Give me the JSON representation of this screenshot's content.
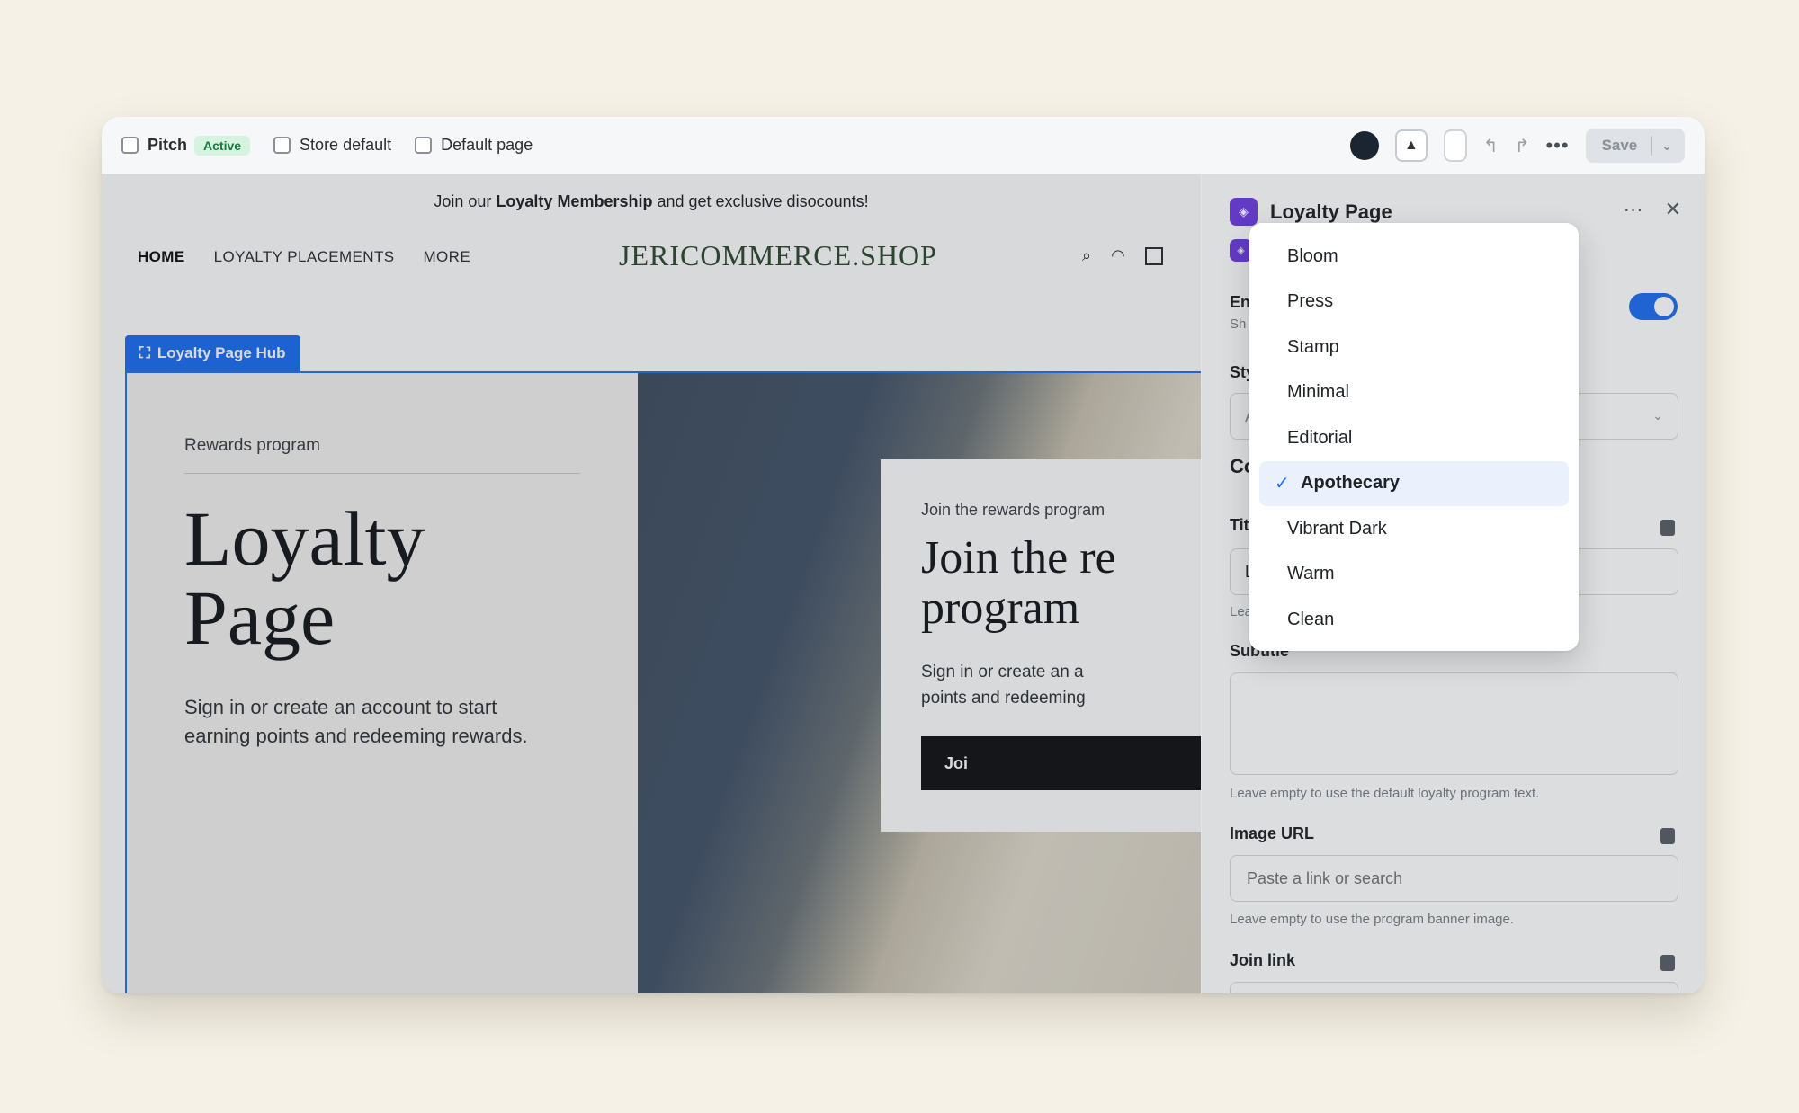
{
  "toolbar": {
    "pitch_label": "Pitch",
    "active_badge": "Active",
    "store_default_label": "Store default",
    "default_page_label": "Default page",
    "save_label": "Save"
  },
  "store": {
    "announcement_prefix": "Join our ",
    "announcement_bold": "Loyalty Membership",
    "announcement_suffix": " and get exclusive disocounts!",
    "nav": {
      "home": "HOME",
      "loyalty_placements": "LOYALTY PLACEMENTS",
      "more": "MORE"
    },
    "logo": "JERICOMMERCE.SHOP"
  },
  "hub": {
    "tag_label": "Loyalty Page Hub",
    "eyebrow": "Rewards program",
    "title_line1": "Loyalty",
    "title_line2": "Page",
    "description": "Sign in or create an account to start earning points and redeeming rewards.",
    "promo": {
      "eyebrow": "Join the rewards program",
      "title_line1": "Join the re",
      "title_line2": "program",
      "desc_line1": "Sign in or create an a",
      "desc_line2": "points and redeeming",
      "button": "Joi"
    }
  },
  "panel": {
    "title": "Loyalty Page",
    "enable_label": "En",
    "enable_help": "Sh",
    "style_label": "Sty",
    "style_value": "A",
    "section_label": "Co",
    "title_field_label": "Tit",
    "title_field_value": "L",
    "title_help": "Lea",
    "subtitle_label": "Subtitle",
    "subtitle_help": "Leave empty to use the default loyalty program text.",
    "image_url_label": "Image URL",
    "image_url_placeholder": "Paste a link or search",
    "image_url_help": "Leave empty to use the program banner image.",
    "join_link_label": "Join link"
  },
  "dropdown": {
    "options": [
      "Bloom",
      "Press",
      "Stamp",
      "Minimal",
      "Editorial",
      "Apothecary",
      "Vibrant Dark",
      "Warm",
      "Clean"
    ],
    "selected": "Apothecary"
  },
  "colors": {
    "accent": "#1f6ff2",
    "brand_purple": "#6d3ee0",
    "logo_green": "#2e4a31"
  }
}
